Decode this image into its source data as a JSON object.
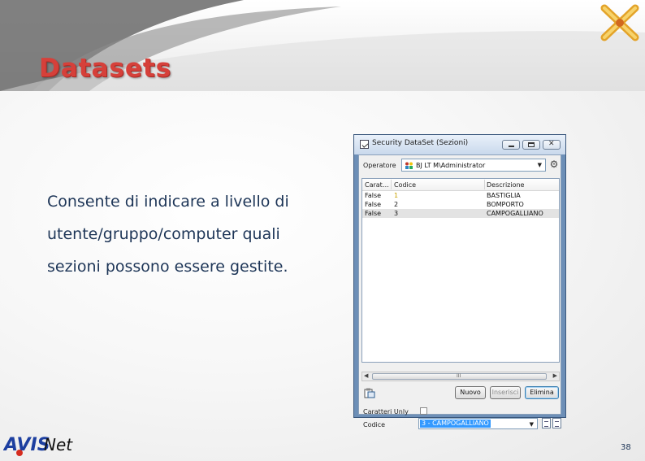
{
  "slide": {
    "title": "Datasets",
    "body": "Consente di indicare a livello di utente/gruppo/computer quali sezioni possono essere gestite.",
    "page_number": "38",
    "footer_logo": "AVISNet",
    "brand_logo_icon": "x-logo-icon"
  },
  "dialog": {
    "title": "Security DataSet (Sezioni)",
    "operator_label": "Operatore",
    "operator_value": "BJ LT M\\Administrator",
    "columns": [
      "Carat…",
      "Codice",
      "Descrizione"
    ],
    "rows": [
      {
        "flag": "False",
        "code": "1",
        "desc": "BASTIGLIA"
      },
      {
        "flag": "False",
        "code": "2",
        "desc": "BOMPORTO"
      },
      {
        "flag": "False",
        "code": "3",
        "desc": "CAMPOGALLIANO"
      }
    ],
    "buttons": {
      "new": "Nuovo",
      "insert": "Inserisci",
      "delete": "Elimina"
    },
    "readonly_label": "Caratteri Unly",
    "code_label": "Codice",
    "code_value": "3 - CAMPOGALLIANO",
    "scroll_grip": "III",
    "colors": {
      "accent": "#d6403a",
      "text": "#1d3557",
      "selection": "#3399ff",
      "yellow_text": "#c8a200"
    }
  }
}
